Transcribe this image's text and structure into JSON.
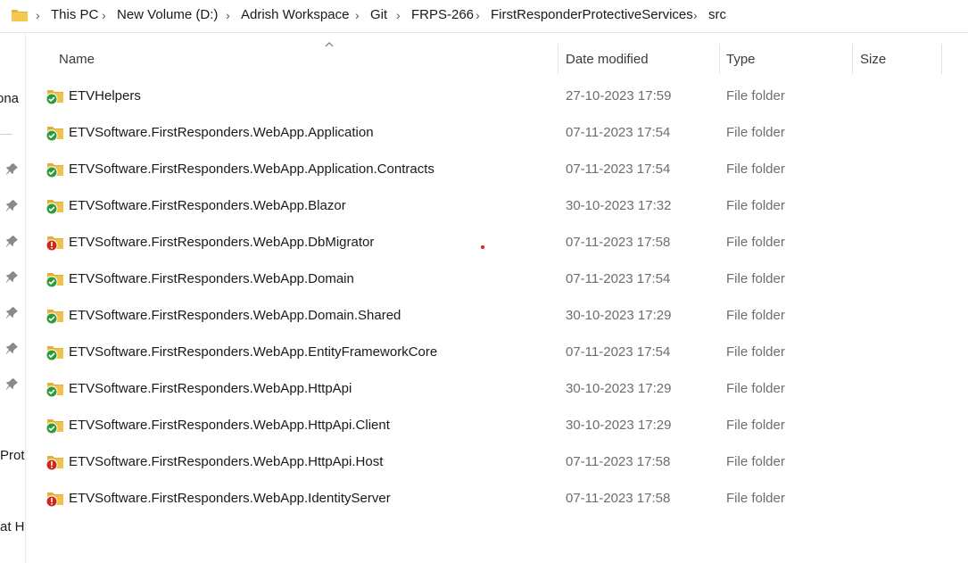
{
  "breadcrumb": [
    "This PC",
    "New Volume (D:)",
    "Adrish Workspace",
    "Git",
    "FRPS-266",
    "FirstResponderProtectiveServices",
    "src"
  ],
  "nav_pane": {
    "fragments": [
      "ona",
      "Prot",
      "at H"
    ]
  },
  "columns": {
    "name": "Name",
    "date_modified": "Date modified",
    "type": "Type",
    "size": "Size"
  },
  "files": [
    {
      "name": "ETVHelpers",
      "date": "27-10-2023 17:59",
      "type": "File folder",
      "status": "ok"
    },
    {
      "name": "ETVSoftware.FirstResponders.WebApp.Application",
      "date": "07-11-2023 17:54",
      "type": "File folder",
      "status": "ok"
    },
    {
      "name": "ETVSoftware.FirstResponders.WebApp.Application.Contracts",
      "date": "07-11-2023 17:54",
      "type": "File folder",
      "status": "ok"
    },
    {
      "name": "ETVSoftware.FirstResponders.WebApp.Blazor",
      "date": "30-10-2023 17:32",
      "type": "File folder",
      "status": "ok"
    },
    {
      "name": "ETVSoftware.FirstResponders.WebApp.DbMigrator",
      "date": "07-11-2023 17:58",
      "type": "File folder",
      "status": "error"
    },
    {
      "name": "ETVSoftware.FirstResponders.WebApp.Domain",
      "date": "07-11-2023 17:54",
      "type": "File folder",
      "status": "ok"
    },
    {
      "name": "ETVSoftware.FirstResponders.WebApp.Domain.Shared",
      "date": "30-10-2023 17:29",
      "type": "File folder",
      "status": "ok"
    },
    {
      "name": "ETVSoftware.FirstResponders.WebApp.EntityFrameworkCore",
      "date": "07-11-2023 17:54",
      "type": "File folder",
      "status": "ok"
    },
    {
      "name": "ETVSoftware.FirstResponders.WebApp.HttpApi",
      "date": "30-10-2023 17:29",
      "type": "File folder",
      "status": "ok"
    },
    {
      "name": "ETVSoftware.FirstResponders.WebApp.HttpApi.Client",
      "date": "30-10-2023 17:29",
      "type": "File folder",
      "status": "ok"
    },
    {
      "name": "ETVSoftware.FirstResponders.WebApp.HttpApi.Host",
      "date": "07-11-2023 17:58",
      "type": "File folder",
      "status": "error"
    },
    {
      "name": "ETVSoftware.FirstResponders.WebApp.IdentityServer",
      "date": "07-11-2023 17:58",
      "type": "File folder",
      "status": "error"
    }
  ],
  "colors": {
    "folder": "#f0c24b",
    "ok_badge": "#2e9b3a",
    "error_badge": "#d0271d",
    "accent_dot": "#e0201b"
  },
  "icons": {
    "address_folder": "folder-icon",
    "ok": "git-synced-icon",
    "error": "git-modified-icon",
    "pin": "pin-icon",
    "sort": "sort-ascending-icon"
  }
}
